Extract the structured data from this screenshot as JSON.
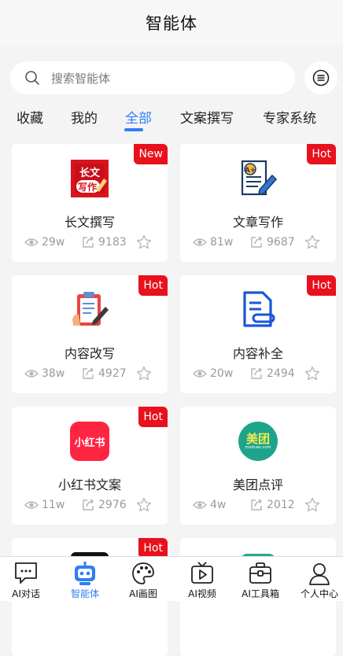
{
  "header": {
    "title": "智能体"
  },
  "search": {
    "placeholder": "搜索智能体"
  },
  "tabs": [
    {
      "label": "收藏"
    },
    {
      "label": "我的"
    },
    {
      "label": "全部"
    },
    {
      "label": "文案撰写"
    },
    {
      "label": "专家系统"
    }
  ],
  "cards": [
    {
      "name": "长文撰写",
      "badge": "New",
      "views": "29w",
      "shares": "9183",
      "logo_text": "长文写作"
    },
    {
      "name": "文章写作",
      "badge": "Hot",
      "views": "81w",
      "shares": "9687"
    },
    {
      "name": "内容改写",
      "badge": "Hot",
      "views": "38w",
      "shares": "4927"
    },
    {
      "name": "内容补全",
      "badge": "Hot",
      "views": "20w",
      "shares": "2494"
    },
    {
      "name": "小红书文案",
      "badge": "Hot",
      "views": "11w",
      "shares": "2976",
      "logo_text": "小红书"
    },
    {
      "name": "美团点评",
      "badge": "",
      "views": "4w",
      "shares": "2012",
      "logo_text": "美团",
      "logo_sub": "meituan.com"
    },
    {
      "name": "",
      "badge": "Hot",
      "views": "",
      "shares": ""
    },
    {
      "name": "",
      "badge": "",
      "views": "",
      "shares": ""
    }
  ],
  "bottom_nav": [
    {
      "label": "AI对话",
      "icon": "chat-icon"
    },
    {
      "label": "智能体",
      "icon": "robot-icon"
    },
    {
      "label": "AI画图",
      "icon": "palette-icon"
    },
    {
      "label": "AI视频",
      "icon": "tv-play-icon"
    },
    {
      "label": "AI工具箱",
      "icon": "toolbox-icon"
    },
    {
      "label": "个人中心",
      "icon": "person-icon"
    }
  ],
  "colors": {
    "accent": "#2f7ef6",
    "badge": "#e8111c",
    "xiaohongshu": "#ff2442",
    "meituan": "#1fa48c"
  }
}
